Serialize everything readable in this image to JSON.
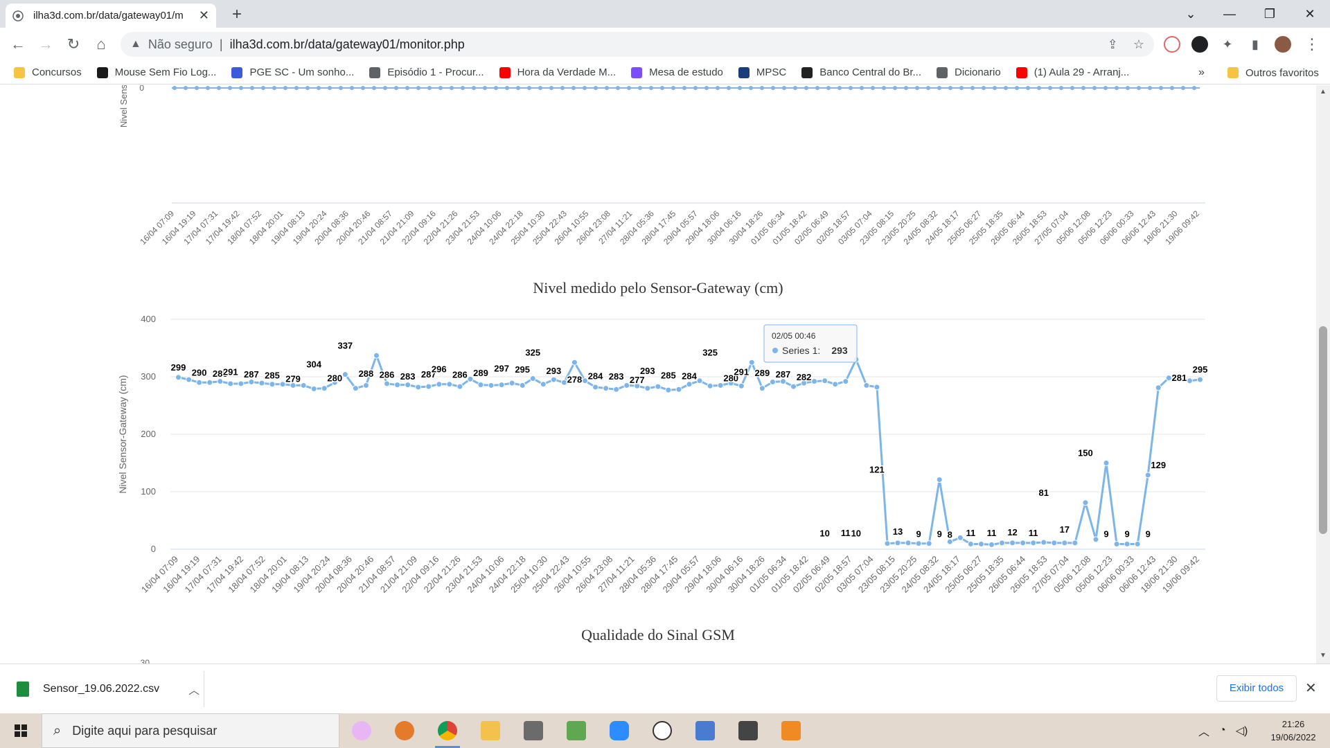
{
  "browser": {
    "tab_title": "ilha3d.com.br/data/gateway01/m",
    "security_label": "Não seguro",
    "url": "ilha3d.com.br/data/gateway01/monitor.php",
    "bookmarks": [
      {
        "label": "Concursos",
        "icon": "folder-icon",
        "color": "#f6c342"
      },
      {
        "label": "Mouse Sem Fio Log...",
        "icon": "logi-icon",
        "color": "#1a1a1a"
      },
      {
        "label": "PGE SC - Um sonho...",
        "icon": "owl-icon",
        "color": "#3b5bdb"
      },
      {
        "label": "Episódio 1 - Procur...",
        "icon": "globe-icon",
        "color": "#5f6368"
      },
      {
        "label": "Hora da Verdade M...",
        "icon": "youtube-icon",
        "color": "#ff0000"
      },
      {
        "label": "Mesa de estudo",
        "icon": "feather-icon",
        "color": "#7c4dff"
      },
      {
        "label": "MPSC",
        "icon": "mpsc-icon",
        "color": "#1a3d7c"
      },
      {
        "label": "Banco Central do Br...",
        "icon": "bcb-icon",
        "color": "#222222"
      },
      {
        "label": "Dicionario",
        "icon": "globe-icon",
        "color": "#5f6368"
      },
      {
        "label": "(1) Aula 29 - Arranj...",
        "icon": "youtube-icon",
        "color": "#ff0000"
      }
    ],
    "bookmarks_more": "»",
    "bookmarks_others": "Outros favoritos"
  },
  "top_chart": {
    "ylabel": "Nivel Sens",
    "ytick_visible": "0",
    "xticks": [
      "16/04 07:09",
      "16/04 19:19",
      "17/04 07:31",
      "17/04 19:42",
      "18/04 07:52",
      "18/04 20:01",
      "19/04 08:13",
      "19/04 20:24",
      "20/04 08:36",
      "20/04 20:46",
      "21/04 08:57",
      "21/04 21:09",
      "22/04 09:16",
      "22/04 21:26",
      "23/04 21:53",
      "24/04 10:06",
      "24/04 22:18",
      "25/04 10:30",
      "25/04 22:43",
      "26/04 10:55",
      "26/04 23:08",
      "27/04 11:21",
      "28/04 05:36",
      "28/04 17:45",
      "29/04 05:57",
      "29/04 18:06",
      "30/04 06:16",
      "30/04 18:26",
      "01/05 06:34",
      "01/05 18:42",
      "02/05 06:49",
      "02/05 18:57",
      "03/05 07:04",
      "23/05 08:15",
      "23/05 20:25",
      "24/05 08:32",
      "24/05 18:17",
      "25/05 06:27",
      "25/05 18:35",
      "26/05 06:44",
      "26/05 18:53",
      "27/05 07:04",
      "05/06 12:08",
      "05/06 12:23",
      "06/06 00:33",
      "06/06 12:43",
      "18/06 21:30",
      "19/06 09:42"
    ]
  },
  "chart_data": {
    "type": "line",
    "title": "Nivel medido pelo Sensor-Gateway (cm)",
    "ylabel": "Nivel Sensor-Gateway (cm)",
    "xlabel": "",
    "ylim": [
      0,
      400
    ],
    "yticks": [
      "0",
      "100",
      "200",
      "300",
      "400"
    ],
    "xticks": [
      "16/04 07:09",
      "16/04 19:19",
      "17/04 07:31",
      "17/04 19:42",
      "18/04 07:52",
      "18/04 20:01",
      "19/04 08:13",
      "19/04 20:24",
      "20/04 08:36",
      "20/04 20:46",
      "21/04 08:57",
      "21/04 21:09",
      "22/04 09:16",
      "22/04 21:26",
      "23/04 21:53",
      "24/04 10:06",
      "24/04 22:18",
      "25/04 10:30",
      "25/04 22:43",
      "26/04 10:55",
      "26/04 23:08",
      "27/04 11:21",
      "28/04 05:36",
      "28/04 17:45",
      "29/04 05:57",
      "29/04 18:06",
      "30/04 06:16",
      "30/04 18:26",
      "01/05 06:34",
      "01/05 18:42",
      "02/05 06:49",
      "02/05 18:57",
      "03/05 07:04",
      "23/05 08:15",
      "23/05 20:25",
      "24/05 08:32",
      "24/05 18:17",
      "25/05 06:27",
      "25/05 18:35",
      "26/05 06:44",
      "26/05 18:53",
      "27/05 07:04",
      "05/06 12:08",
      "05/06 12:23",
      "06/06 00:33",
      "06/06 12:43",
      "18/06 21:30",
      "19/06 09:42"
    ],
    "series": [
      {
        "name": "Series 1",
        "color": "#7cb5ec",
        "values": [
          299,
          295,
          290,
          290,
          292,
          288,
          288,
          291,
          289,
          287,
          287,
          285,
          285,
          279,
          280,
          290,
          304,
          280,
          285,
          337,
          288,
          286,
          286,
          282,
          283,
          287,
          287,
          283,
          296,
          286,
          285,
          286,
          289,
          285,
          297,
          287,
          295,
          290,
          325,
          293,
          282,
          280,
          278,
          285,
          284,
          280,
          283,
          277,
          278,
          287,
          293,
          284,
          285,
          289,
          284,
          325,
          280,
          291,
          292,
          283,
          289,
          292,
          293,
          287,
          292,
          330,
          285,
          282,
          10,
          11,
          11,
          10,
          10,
          121,
          13,
          20,
          9,
          9,
          8,
          11,
          11,
          11,
          11,
          12,
          11,
          11,
          11,
          81,
          17,
          150,
          9,
          9,
          9,
          129,
          281,
          298,
          295,
          293,
          295
        ]
      }
    ],
    "data_labels": [
      "299",
      "290",
      "288",
      "291",
      "287",
      "285",
      "279",
      "304",
      "280",
      "337",
      "288",
      "286",
      "283",
      "287",
      "296",
      "286",
      "289",
      "297",
      "295",
      "325",
      "293",
      "278",
      "284",
      "283",
      "277",
      "293",
      "285",
      "284",
      "325",
      "280",
      "291",
      "289",
      "287",
      "282",
      "10",
      "11",
      "10",
      "121",
      "13",
      "9",
      "9",
      "8",
      "11",
      "11",
      "12",
      "11",
      "81",
      "17",
      "150",
      "9",
      "9",
      "9",
      "129",
      "281",
      "295"
    ],
    "tooltip": {
      "header": "02/05 00:46",
      "series": "Series 1",
      "value": "293"
    }
  },
  "next_chart": {
    "title": "Qualidade do Sinal GSM",
    "ytick_visible": "30"
  },
  "download": {
    "filename": "Sensor_19.06.2022.csv",
    "show_all": "Exibir todos"
  },
  "taskbar": {
    "search_placeholder": "Digite aqui para pesquisar",
    "time": "21:26",
    "date": "19/06/2022"
  }
}
